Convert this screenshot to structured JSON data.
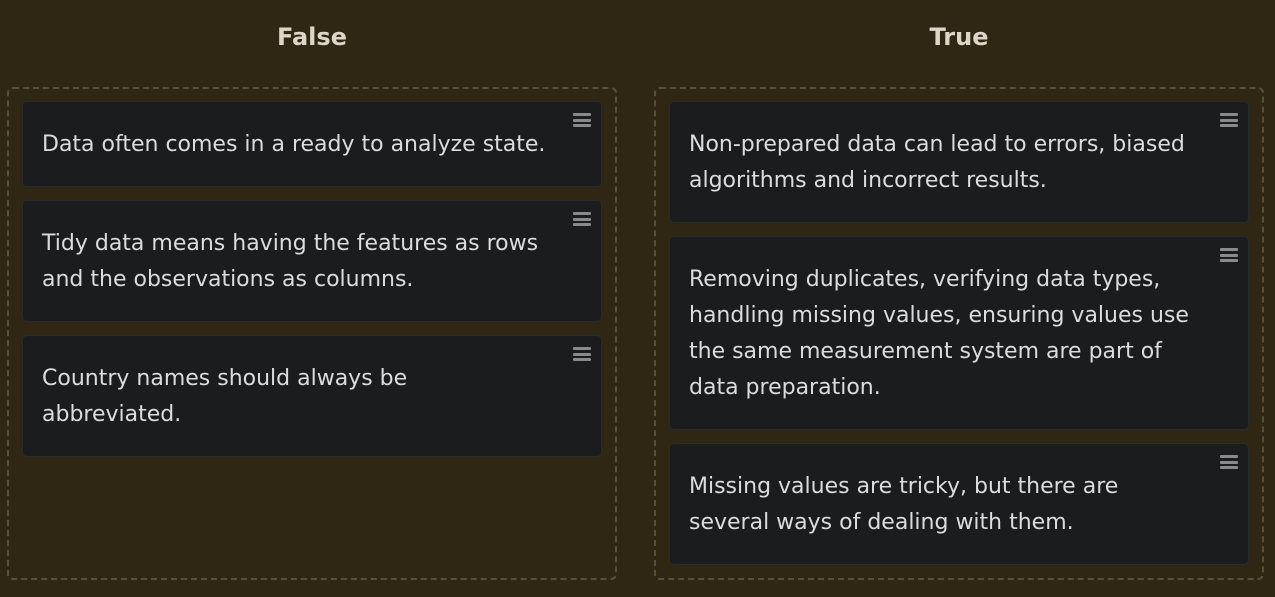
{
  "columns": [
    {
      "title": "False",
      "cards": [
        {
          "text": "Data often comes in a ready to analyze state."
        },
        {
          "text": "Tidy data means having the features as rows and the observations as columns."
        },
        {
          "text": "Country names should always be abbreviated."
        }
      ]
    },
    {
      "title": "True",
      "cards": [
        {
          "text": "Non-prepared data can lead to errors, biased algorithms and incorrect results."
        },
        {
          "text": "Removing duplicates, verifying data types, handling missing values, ensuring values use the same measurement system are part of data preparation."
        },
        {
          "text": "Missing values are tricky, but there are several ways of dealing with them."
        }
      ]
    }
  ],
  "icons": {
    "drag_handle": "drag-handle-icon"
  },
  "colors": {
    "background": "#2f2613",
    "card": "#1b1c1e",
    "dropzone_border": "#5a4f3a",
    "title_text": "#ddd6c8",
    "card_text": "#dcdcdc"
  }
}
